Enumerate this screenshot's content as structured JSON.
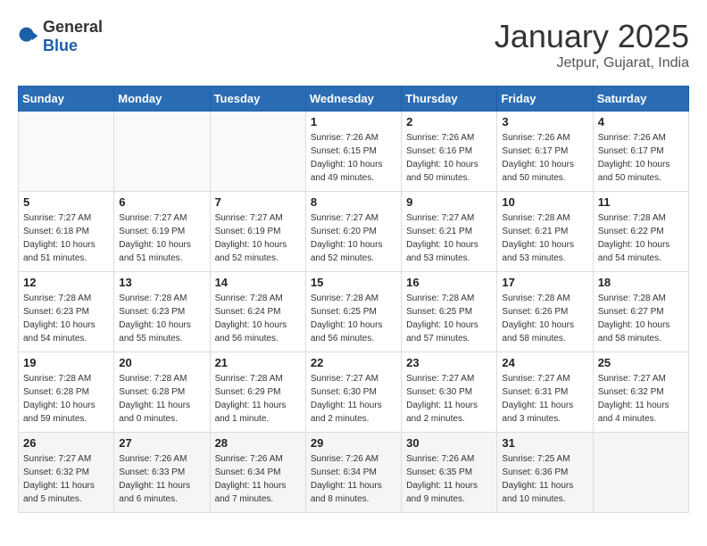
{
  "logo": {
    "general": "General",
    "blue": "Blue"
  },
  "title": "January 2025",
  "location": "Jetpur, Gujarat, India",
  "weekdays": [
    "Sunday",
    "Monday",
    "Tuesday",
    "Wednesday",
    "Thursday",
    "Friday",
    "Saturday"
  ],
  "weeks": [
    [
      {
        "day": "",
        "info": ""
      },
      {
        "day": "",
        "info": ""
      },
      {
        "day": "",
        "info": ""
      },
      {
        "day": "1",
        "info": "Sunrise: 7:26 AM\nSunset: 6:15 PM\nDaylight: 10 hours\nand 49 minutes."
      },
      {
        "day": "2",
        "info": "Sunrise: 7:26 AM\nSunset: 6:16 PM\nDaylight: 10 hours\nand 50 minutes."
      },
      {
        "day": "3",
        "info": "Sunrise: 7:26 AM\nSunset: 6:17 PM\nDaylight: 10 hours\nand 50 minutes."
      },
      {
        "day": "4",
        "info": "Sunrise: 7:26 AM\nSunset: 6:17 PM\nDaylight: 10 hours\nand 50 minutes."
      }
    ],
    [
      {
        "day": "5",
        "info": "Sunrise: 7:27 AM\nSunset: 6:18 PM\nDaylight: 10 hours\nand 51 minutes."
      },
      {
        "day": "6",
        "info": "Sunrise: 7:27 AM\nSunset: 6:19 PM\nDaylight: 10 hours\nand 51 minutes."
      },
      {
        "day": "7",
        "info": "Sunrise: 7:27 AM\nSunset: 6:19 PM\nDaylight: 10 hours\nand 52 minutes."
      },
      {
        "day": "8",
        "info": "Sunrise: 7:27 AM\nSunset: 6:20 PM\nDaylight: 10 hours\nand 52 minutes."
      },
      {
        "day": "9",
        "info": "Sunrise: 7:27 AM\nSunset: 6:21 PM\nDaylight: 10 hours\nand 53 minutes."
      },
      {
        "day": "10",
        "info": "Sunrise: 7:28 AM\nSunset: 6:21 PM\nDaylight: 10 hours\nand 53 minutes."
      },
      {
        "day": "11",
        "info": "Sunrise: 7:28 AM\nSunset: 6:22 PM\nDaylight: 10 hours\nand 54 minutes."
      }
    ],
    [
      {
        "day": "12",
        "info": "Sunrise: 7:28 AM\nSunset: 6:23 PM\nDaylight: 10 hours\nand 54 minutes."
      },
      {
        "day": "13",
        "info": "Sunrise: 7:28 AM\nSunset: 6:23 PM\nDaylight: 10 hours\nand 55 minutes."
      },
      {
        "day": "14",
        "info": "Sunrise: 7:28 AM\nSunset: 6:24 PM\nDaylight: 10 hours\nand 56 minutes."
      },
      {
        "day": "15",
        "info": "Sunrise: 7:28 AM\nSunset: 6:25 PM\nDaylight: 10 hours\nand 56 minutes."
      },
      {
        "day": "16",
        "info": "Sunrise: 7:28 AM\nSunset: 6:25 PM\nDaylight: 10 hours\nand 57 minutes."
      },
      {
        "day": "17",
        "info": "Sunrise: 7:28 AM\nSunset: 6:26 PM\nDaylight: 10 hours\nand 58 minutes."
      },
      {
        "day": "18",
        "info": "Sunrise: 7:28 AM\nSunset: 6:27 PM\nDaylight: 10 hours\nand 58 minutes."
      }
    ],
    [
      {
        "day": "19",
        "info": "Sunrise: 7:28 AM\nSunset: 6:28 PM\nDaylight: 10 hours\nand 59 minutes."
      },
      {
        "day": "20",
        "info": "Sunrise: 7:28 AM\nSunset: 6:28 PM\nDaylight: 11 hours\nand 0 minutes."
      },
      {
        "day": "21",
        "info": "Sunrise: 7:28 AM\nSunset: 6:29 PM\nDaylight: 11 hours\nand 1 minute."
      },
      {
        "day": "22",
        "info": "Sunrise: 7:27 AM\nSunset: 6:30 PM\nDaylight: 11 hours\nand 2 minutes."
      },
      {
        "day": "23",
        "info": "Sunrise: 7:27 AM\nSunset: 6:30 PM\nDaylight: 11 hours\nand 2 minutes."
      },
      {
        "day": "24",
        "info": "Sunrise: 7:27 AM\nSunset: 6:31 PM\nDaylight: 11 hours\nand 3 minutes."
      },
      {
        "day": "25",
        "info": "Sunrise: 7:27 AM\nSunset: 6:32 PM\nDaylight: 11 hours\nand 4 minutes."
      }
    ],
    [
      {
        "day": "26",
        "info": "Sunrise: 7:27 AM\nSunset: 6:32 PM\nDaylight: 11 hours\nand 5 minutes."
      },
      {
        "day": "27",
        "info": "Sunrise: 7:26 AM\nSunset: 6:33 PM\nDaylight: 11 hours\nand 6 minutes."
      },
      {
        "day": "28",
        "info": "Sunrise: 7:26 AM\nSunset: 6:34 PM\nDaylight: 11 hours\nand 7 minutes."
      },
      {
        "day": "29",
        "info": "Sunrise: 7:26 AM\nSunset: 6:34 PM\nDaylight: 11 hours\nand 8 minutes."
      },
      {
        "day": "30",
        "info": "Sunrise: 7:26 AM\nSunset: 6:35 PM\nDaylight: 11 hours\nand 9 minutes."
      },
      {
        "day": "31",
        "info": "Sunrise: 7:25 AM\nSunset: 6:36 PM\nDaylight: 11 hours\nand 10 minutes."
      },
      {
        "day": "",
        "info": ""
      }
    ]
  ]
}
